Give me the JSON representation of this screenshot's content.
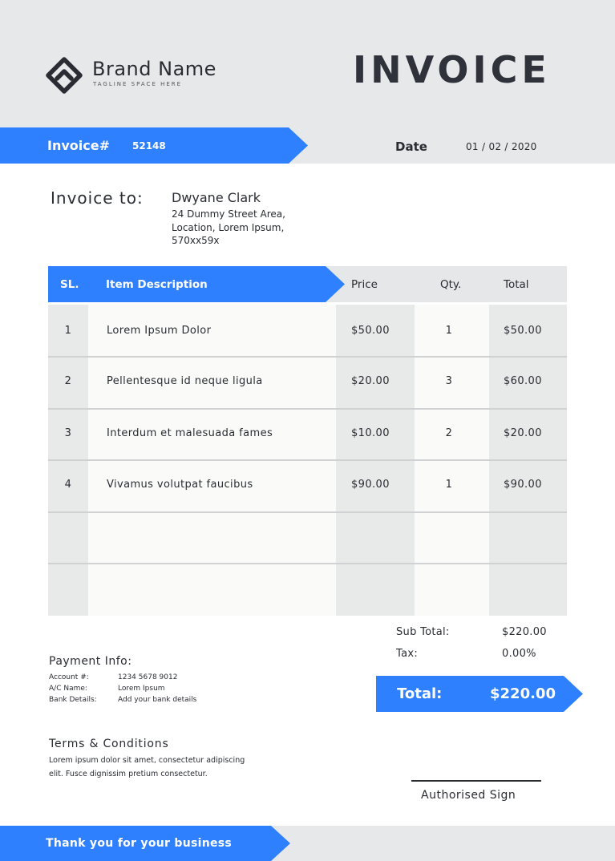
{
  "colors": {
    "accent": "#2f80ff",
    "dark": "#2a2c33",
    "light_gray": "#e7e8ea"
  },
  "brand": {
    "name": "Brand Name",
    "tagline": "TAGLINE SPACE HERE",
    "logo_icon": "rounded-diamond-logo-icon"
  },
  "title": "INVOICE",
  "invoice": {
    "label": "Invoice#",
    "number": "52148",
    "date_label": "Date",
    "date": "01 / 02 / 2020"
  },
  "bill_to": {
    "label": "Invoice to:",
    "name": "Dwyane Clark",
    "address": [
      "24 Dummy Street Area,",
      "Location, Lorem Ipsum,",
      "570xx59x"
    ]
  },
  "table": {
    "headers": {
      "sl": "SL.",
      "description": "Item Description",
      "price": "Price",
      "qty": "Qty.",
      "total": "Total"
    },
    "rows": [
      {
        "sl": "1",
        "description": "Lorem Ipsum Dolor",
        "price": "$50.00",
        "qty": "1",
        "total": "$50.00"
      },
      {
        "sl": "2",
        "description": "Pellentesque id neque ligula",
        "price": "$20.00",
        "qty": "3",
        "total": "$60.00"
      },
      {
        "sl": "3",
        "description": "Interdum et malesuada fames",
        "price": "$10.00",
        "qty": "2",
        "total": "$20.00"
      },
      {
        "sl": "4",
        "description": "Vivamus volutpat faucibus",
        "price": "$90.00",
        "qty": "1",
        "total": "$90.00"
      }
    ]
  },
  "summary": {
    "subtotal_label": "Sub Total:",
    "subtotal": "$220.00",
    "tax_label": "Tax:",
    "tax": "0.00%",
    "total_label": "Total:",
    "total": "$220.00"
  },
  "payment": {
    "title": "Payment Info:",
    "rows": [
      {
        "label": "Account #:",
        "value": "1234 5678 9012"
      },
      {
        "label": "A/C Name:",
        "value": "Lorem Ipsum"
      },
      {
        "label": "Bank Details:",
        "value": "Add your bank details"
      }
    ]
  },
  "terms": {
    "title": "Terms & Conditions",
    "lines": [
      "Lorem ipsum dolor sit amet, consectetur adipiscing",
      "elit. Fusce dignissim pretium consectetur."
    ]
  },
  "signature": {
    "label": "Authorised Sign"
  },
  "footer": {
    "text": "Thank you for your business"
  }
}
